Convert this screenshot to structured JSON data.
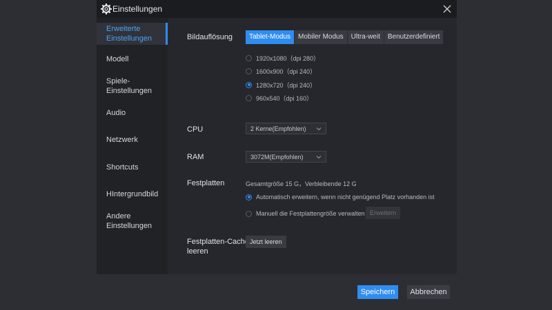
{
  "window": {
    "title": "Einstellungen"
  },
  "nav": {
    "items": [
      {
        "lines": [
          "Erweiterte",
          "Einstellungen"
        ],
        "active": true
      },
      {
        "lines": [
          "Modell"
        ]
      },
      {
        "lines": [
          "Spiele-",
          "Einstellungen"
        ]
      },
      {
        "lines": [
          "Audio"
        ]
      },
      {
        "lines": [
          "Netzwerk"
        ]
      },
      {
        "lines": [
          "Shortcuts"
        ]
      },
      {
        "lines": [
          "HIntergrundbild"
        ]
      },
      {
        "lines": [
          "Andere",
          "Einstellungen"
        ]
      }
    ]
  },
  "resolution": {
    "label": "Bildauflösung",
    "modes": [
      "Tablet-Modus",
      "Mobiler Modus",
      "Ultra-weit",
      "Benutzerdefiniert"
    ],
    "active_mode": "Tablet-Modus",
    "options": [
      "1920x1080（dpi 280）",
      "1600x900（dpi 240）",
      "1280x720（dpi 240）",
      "960x540（dpi 160）"
    ],
    "selected": "1280x720（dpi 240）"
  },
  "cpu": {
    "label": "CPU",
    "value": "2 Kerne(Empfohlen)"
  },
  "ram": {
    "label": "RAM",
    "value": "3072M(Empfohlen)"
  },
  "disk": {
    "label": "Festplatten",
    "info": "Gesamtgröße 15 G，Verbleibende 12 G",
    "option_auto": "Automatisch erweitern, wenn nicht genügend Platz vorhanden ist",
    "option_manual": "Manuell die Festplattengröße verwalten",
    "expand_button": "Erweitern"
  },
  "cache": {
    "label_line1": "Festplatten-Cache",
    "label_line2": "leeren",
    "button": "Jetzt leeren"
  },
  "footer": {
    "save": "Speichern",
    "cancel": "Abbrechen"
  },
  "colors": {
    "accent": "#2f8df0",
    "background": "#26272c",
    "titlebar": "#1b1c20"
  },
  "icons": {
    "title": "gear-icon",
    "close": "close-icon",
    "dropdown": "chevron-down-icon"
  }
}
